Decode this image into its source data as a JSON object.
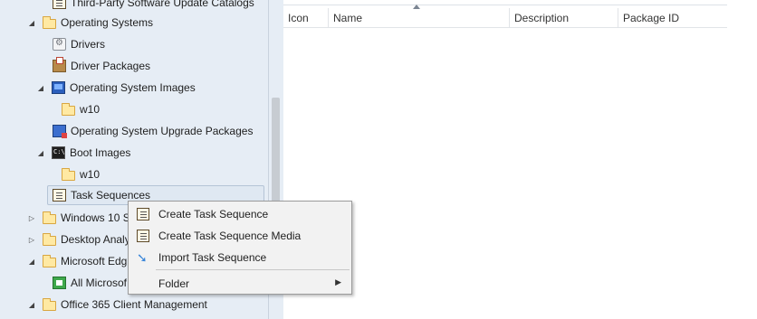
{
  "tree": {
    "items": [
      {
        "label": "Third-Party Software Update Catalogs"
      },
      {
        "label": "Operating Systems"
      },
      {
        "label": "Drivers"
      },
      {
        "label": "Driver Packages"
      },
      {
        "label": "Operating System Images"
      },
      {
        "label": "w10"
      },
      {
        "label": "Operating System Upgrade Packages"
      },
      {
        "label": "Boot Images"
      },
      {
        "label": "w10"
      },
      {
        "label": "Task Sequences"
      },
      {
        "label": "Windows 10 S"
      },
      {
        "label": "Desktop Analy"
      },
      {
        "label": "Microsoft Edg"
      },
      {
        "label": "All Microsof"
      },
      {
        "label": "Office 365 Client Management"
      }
    ]
  },
  "list": {
    "columns": [
      "Icon",
      "Name",
      "Description",
      "Package ID"
    ]
  },
  "context_menu": {
    "items": [
      {
        "label": "Create Task Sequence",
        "icon": "task-sequence-icon"
      },
      {
        "label": "Create Task Sequence Media",
        "icon": "task-sequence-media-icon"
      },
      {
        "label": "Import Task Sequence",
        "icon": "import-arrow-icon"
      },
      {
        "label": "Folder",
        "submenu": true
      }
    ]
  }
}
